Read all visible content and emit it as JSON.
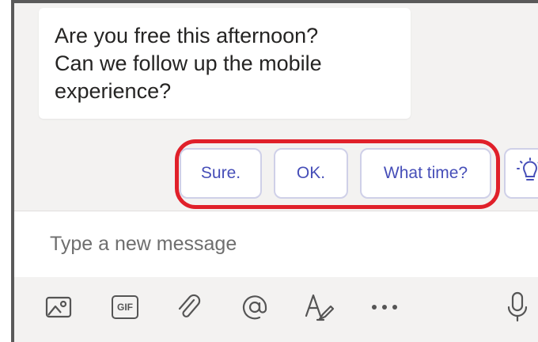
{
  "message": {
    "lines": [
      "Are you free this afternoon?",
      "Can we follow up the mobile",
      "experience?"
    ]
  },
  "suggested_replies": [
    {
      "label": "Sure."
    },
    {
      "label": "OK."
    },
    {
      "label": "What time?"
    }
  ],
  "suggestion_more_icon": "lightbulb-icon",
  "highlight_color": "#e0202a",
  "accent_color": "#464eb8",
  "compose": {
    "placeholder": "Type a new message"
  },
  "toolbar": {
    "icons": [
      "image-icon",
      "gif-icon",
      "attach-icon",
      "mention-icon",
      "format-icon",
      "more-icon",
      "mic-icon"
    ],
    "gif_label": "GIF"
  }
}
